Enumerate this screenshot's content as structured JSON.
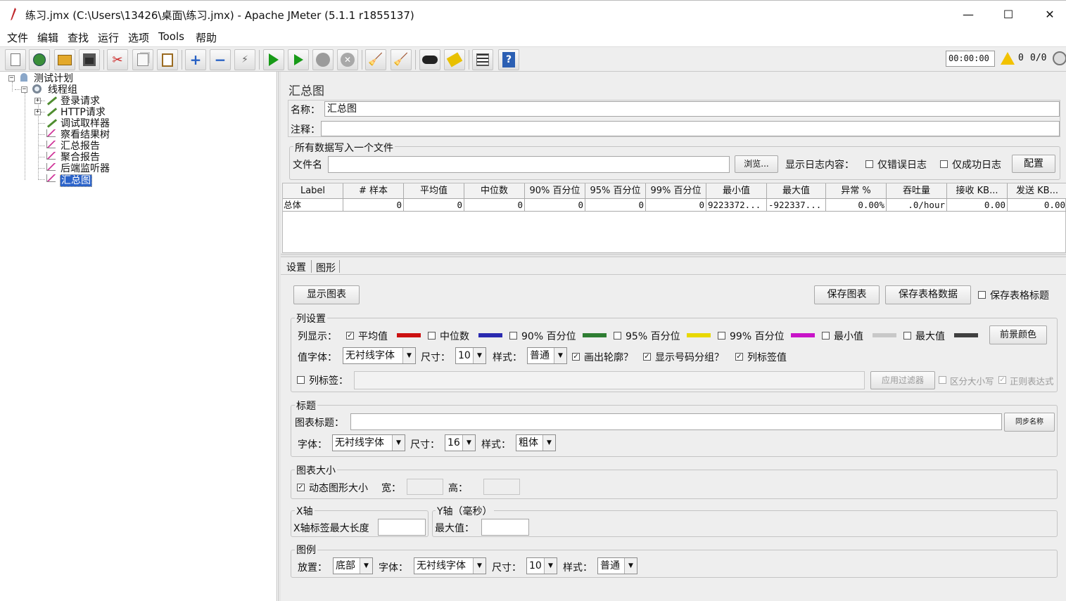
{
  "window": {
    "title": "练习.jmx (C:\\Users\\13426\\桌面\\练习.jmx) - Apache JMeter (5.1.1 r1855137)",
    "minimize": "—",
    "maximize": "☐",
    "close": "✕"
  },
  "menu": [
    "文件",
    "编辑",
    "查找",
    "运行",
    "选项",
    "Tools",
    "帮助"
  ],
  "toolbar": {
    "timer": "00:00:00",
    "warnings": "0",
    "threads": "0/0"
  },
  "tree": {
    "items": [
      "测试计划",
      "线程组",
      "登录请求",
      "HTTP请求",
      "调试取样器",
      "察看结果树",
      "汇总报告",
      "聚合报告",
      "后端监听器",
      "汇总图"
    ]
  },
  "panel": {
    "title": "汇总图",
    "name_label": "名称：",
    "name_value": "汇总图",
    "comment_label": "注释：",
    "file_group": "所有数据写入一个文件",
    "file_label": "文件名",
    "browse": "浏览...",
    "log_label": "显示日志内容：",
    "errors_only": "仅错误日志",
    "success_only": "仅成功日志",
    "configure": "配置"
  },
  "table": {
    "headers": [
      "Label",
      "# 样本",
      "平均值",
      "中位数",
      "90% 百分位",
      "95% 百分位",
      "99% 百分位",
      "最小值",
      "最大值",
      "异常 %",
      "吞吐量",
      "接收 KB...",
      "发送 KB..."
    ],
    "rows": [
      [
        "总体",
        "0",
        "0",
        "0",
        "0",
        "0",
        "0",
        "9223372...",
        "-922337...",
        "0.00%",
        ".0/hour",
        "0.00",
        "0.00"
      ]
    ]
  },
  "tabs": [
    "设置",
    "图形"
  ],
  "settings": {
    "display_graph": "显示图表",
    "save_graph": "保存图表",
    "save_table": "保存表格数据",
    "save_headers": "保存表格标题",
    "col_group": "列设置",
    "col_display": "列显示：",
    "avg": "平均值",
    "median": "中位数",
    "p90": "90% 百分位",
    "p95": "95% 百分位",
    "p99": "99% 百分位",
    "min": "最小值",
    "max": "最大值",
    "fg_color": "前景颜色",
    "colors": {
      "avg": "#cc1111",
      "median": "#2a2ab0",
      "p90": "#2e7d32",
      "p95": "#e8d800",
      "p99": "#c814c8",
      "min": "#c8c8c8",
      "max": "#404040"
    },
    "value_font": "值字体：",
    "font_sans": "无衬线字体",
    "size": "尺寸：",
    "size10": "10",
    "style": "样式：",
    "normal": "普通",
    "outline": "画出轮廓？",
    "group_sep": "显示号码分组？",
    "col_label_vals": "列标签值",
    "col_label": "列标签：",
    "apply_filter": "应用过滤器",
    "case_sensitive": "区分大小写",
    "regex": "正则表达式",
    "title_group": "标题",
    "chart_title": "图表标题：",
    "sync_name": "同步名称",
    "font": "字体：",
    "size16": "16",
    "bold": "粗体",
    "size_group": "图表大小",
    "dynamic": "动态图形大小",
    "width": "宽：",
    "height": "高：",
    "x_group": "X轴",
    "x_max_len": "X轴标签最大长度",
    "y_group": "Y轴（毫秒）",
    "max_value": "最大值：",
    "legend_group": "图例",
    "placement": "放置：",
    "bottom": "底部"
  }
}
